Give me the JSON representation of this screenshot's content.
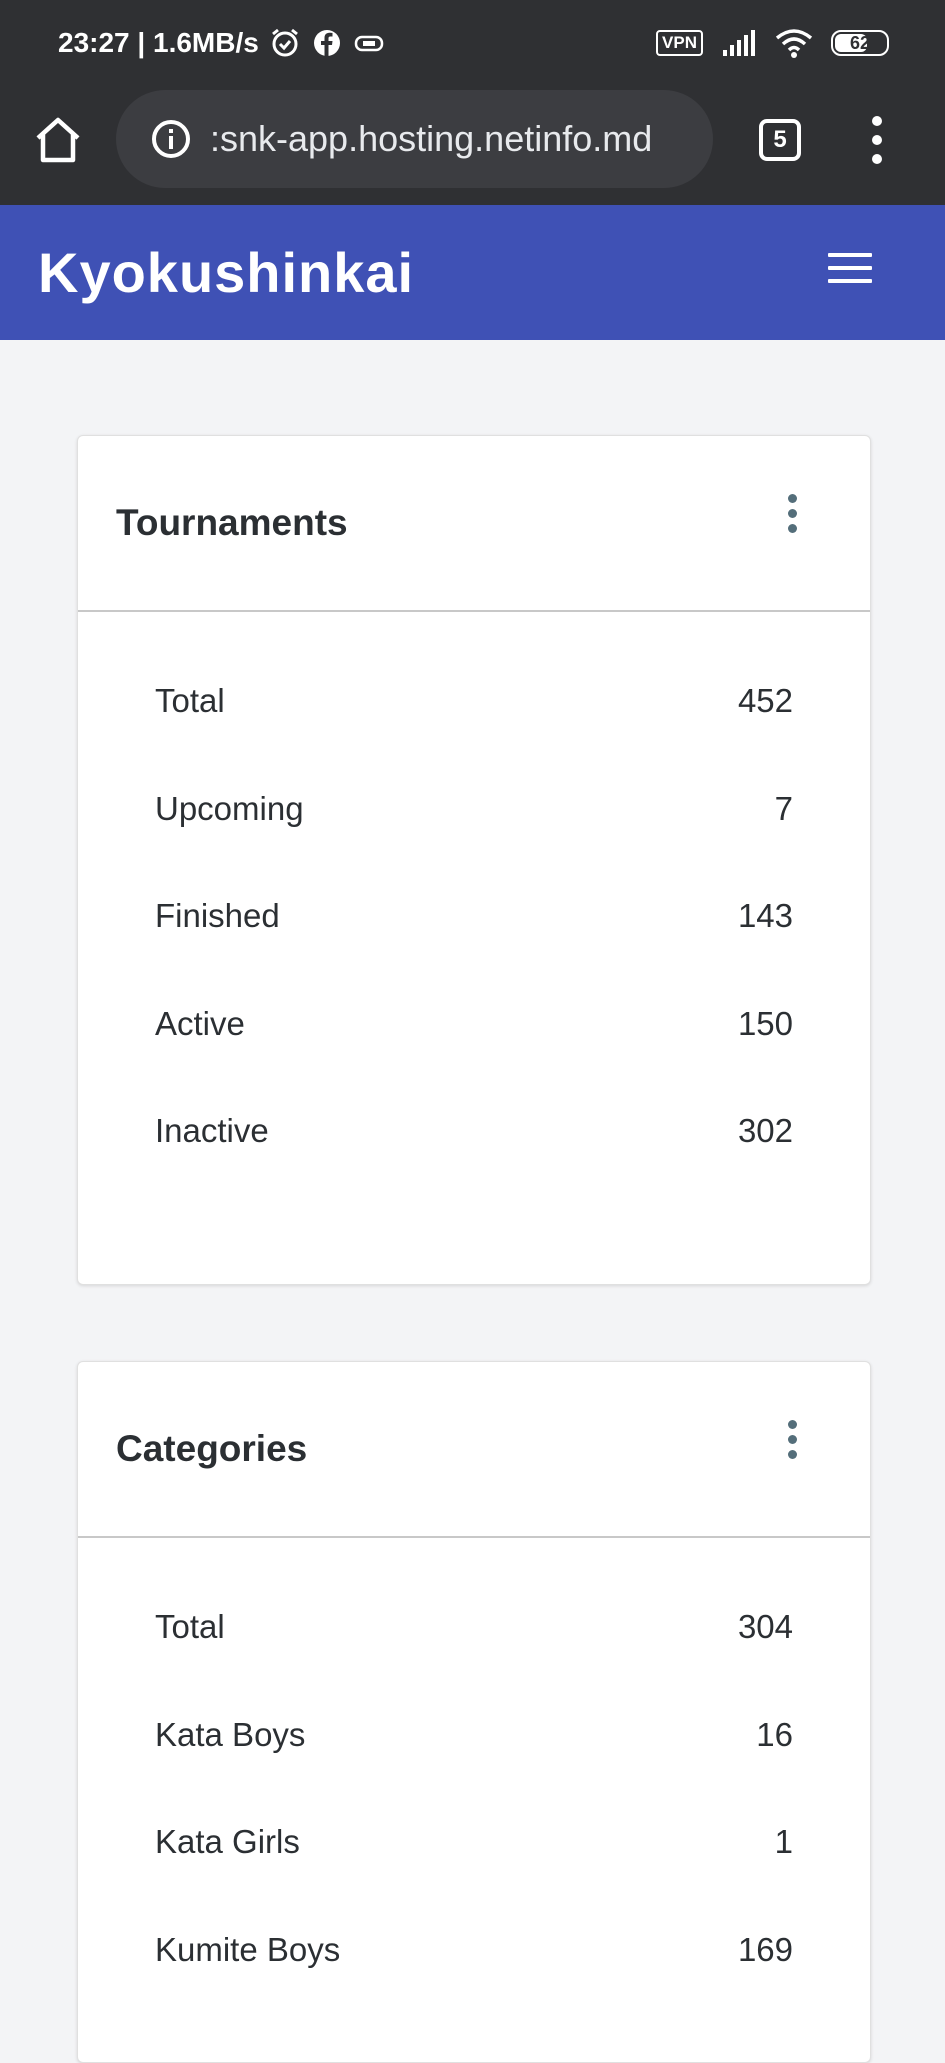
{
  "status_bar": {
    "time_speed": "23:27 | 1.6MB/s",
    "vpn_label": "VPN",
    "battery": "62"
  },
  "browser": {
    "url": ":snk-app.hosting.netinfo.md",
    "tab_count": "5"
  },
  "app_bar": {
    "title": "Kyokushinkai"
  },
  "tournaments": {
    "title": "Tournaments",
    "rows": [
      {
        "label": "Total",
        "value": "452"
      },
      {
        "label": "Upcoming",
        "value": "7"
      },
      {
        "label": "Finished",
        "value": "143"
      },
      {
        "label": "Active",
        "value": "150"
      },
      {
        "label": "Inactive",
        "value": "302"
      }
    ]
  },
  "categories": {
    "title": "Categories",
    "rows": [
      {
        "label": "Total",
        "value": "304"
      },
      {
        "label": "Kata Boys",
        "value": "16"
      },
      {
        "label": "Kata Girls",
        "value": "1"
      },
      {
        "label": "Kumite Boys",
        "value": "169"
      }
    ]
  },
  "colors": {
    "app_bar": "#3f51b5",
    "browser_chrome": "#2f3033",
    "page_background": "#f3f4f6"
  }
}
